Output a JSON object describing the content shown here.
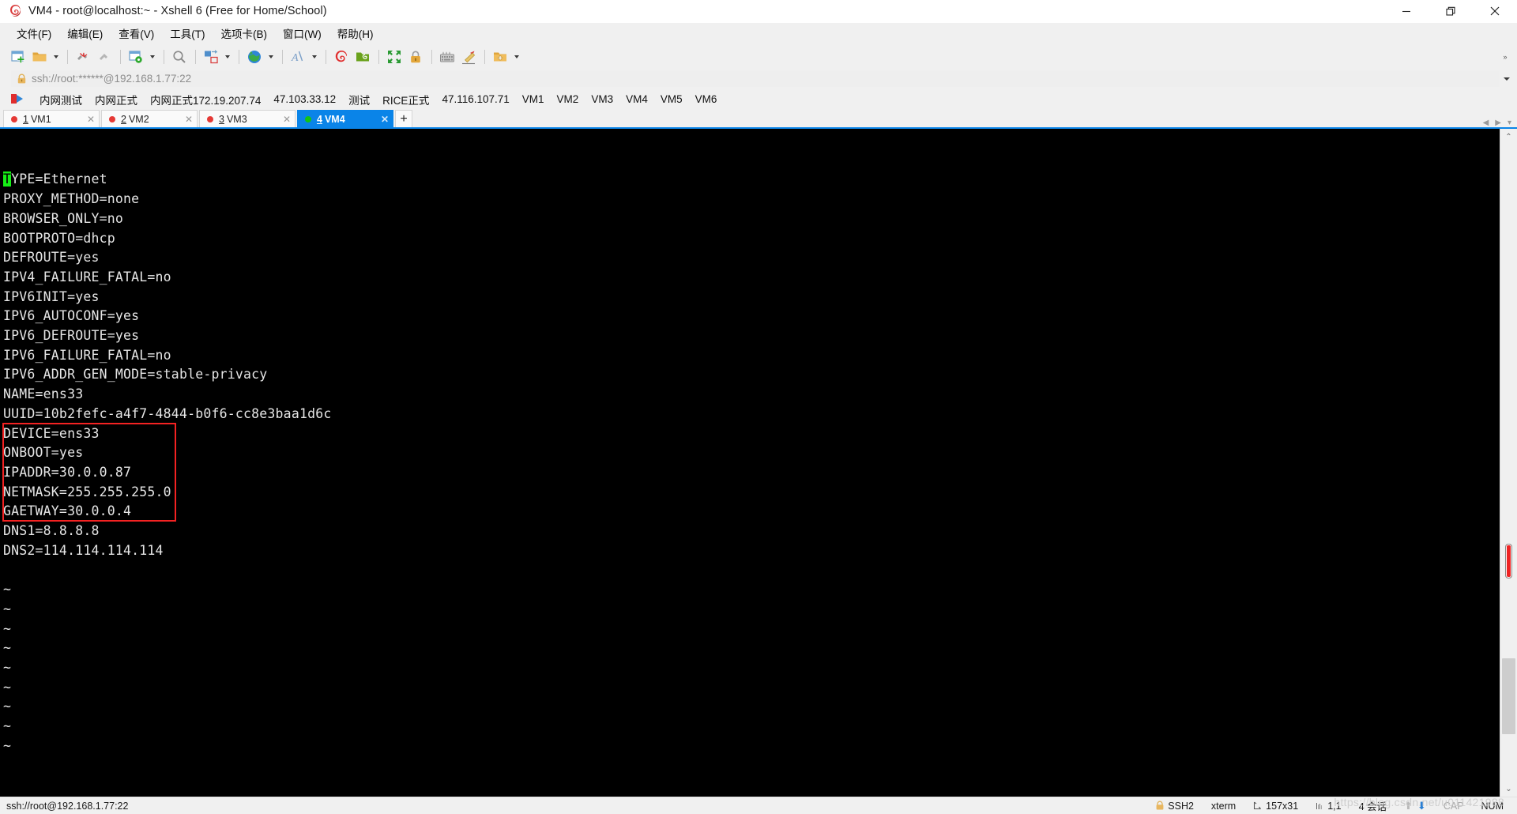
{
  "window": {
    "title": "VM4 - root@localhost:~ - Xshell 6 (Free for Home/School)",
    "app_icon": "xshell-spiral-icon",
    "minimize_label": "—",
    "maximize_label": "❐",
    "close_label": "✕"
  },
  "menu": {
    "items": [
      {
        "label": "文件(F)",
        "name": "menu-file"
      },
      {
        "label": "编辑(E)",
        "name": "menu-edit"
      },
      {
        "label": "查看(V)",
        "name": "menu-view"
      },
      {
        "label": "工具(T)",
        "name": "menu-tools"
      },
      {
        "label": "选项卡(B)",
        "name": "menu-tabs"
      },
      {
        "label": "窗口(W)",
        "name": "menu-window"
      },
      {
        "label": "帮助(H)",
        "name": "menu-help"
      }
    ]
  },
  "toolbar": {
    "collapse_label": "»",
    "buttons": [
      {
        "name": "new-session-icon",
        "title": "新建会话"
      },
      {
        "name": "open-folder-icon",
        "title": "打开"
      },
      {
        "name": "open-dropdown-arrow",
        "title": "打开下拉"
      },
      {
        "name": "disconnect-icon",
        "title": "断开"
      },
      {
        "name": "reconnect-icon",
        "title": "重新连接"
      },
      {
        "name": "session-properties-icon",
        "title": "属性"
      },
      {
        "name": "properties-dropdown-arrow",
        "title": "属性下拉"
      },
      {
        "name": "find-icon",
        "title": "查找"
      },
      {
        "name": "file-transfer-icon",
        "title": "文件传输"
      },
      {
        "name": "file-transfer-dropdown-arrow",
        "title": "文件传输下拉"
      },
      {
        "name": "globe-icon",
        "title": "编码"
      },
      {
        "name": "globe-dropdown-arrow",
        "title": "编码下拉"
      },
      {
        "name": "font-icon",
        "title": "字体"
      },
      {
        "name": "font-dropdown-arrow",
        "title": "字体下拉"
      },
      {
        "name": "xshell-icon",
        "title": "Xshell"
      },
      {
        "name": "xftp-icon",
        "title": "Xftp"
      },
      {
        "name": "fullscreen-icon",
        "title": "全屏"
      },
      {
        "name": "lock-icon",
        "title": "锁定"
      },
      {
        "name": "keyboard-icon",
        "title": "按键脚本"
      },
      {
        "name": "highlight-icon",
        "title": "高亮"
      },
      {
        "name": "add-folder-icon",
        "title": "新建文件夹"
      },
      {
        "name": "add-folder-dropdown-arrow",
        "title": "新建文件夹下拉"
      }
    ]
  },
  "address": {
    "value": "ssh://root:******@192.168.1.77:22",
    "placeholder": "ssh://",
    "lock_icon": "lock-icon",
    "dropdown_icon": "chevron-down-icon"
  },
  "bookmarks": {
    "flag_icon": "bookmark-flag-icon",
    "items": [
      "内网测试",
      "内网正式",
      "内网正式172.19.207.74",
      "47.103.33.12",
      "测试",
      "RICE正式",
      "47.116.107.71",
      "VM1",
      "VM2",
      "VM3",
      "VM4",
      "VM5",
      "VM6"
    ]
  },
  "tabs": {
    "items": [
      {
        "num": "1",
        "label": "VM1",
        "status": "disconnected",
        "active": false,
        "close": "✕"
      },
      {
        "num": "2",
        "label": "VM2",
        "status": "disconnected",
        "active": false,
        "close": "✕"
      },
      {
        "num": "3",
        "label": "VM3",
        "status": "disconnected",
        "active": false,
        "close": "✕"
      },
      {
        "num": "4",
        "label": "VM4",
        "status": "connected",
        "active": true,
        "close": "✕"
      }
    ],
    "new_tab_label": "+",
    "nav_prev": "◀",
    "nav_next": "▶",
    "nav_menu": "▾",
    "active_color": "#0a84e8",
    "connected_color": "#13c413",
    "disconnected_color": "#e53935"
  },
  "terminal": {
    "cursor_char": "T",
    "cursor_color": "#16f016",
    "background": "#000000",
    "foreground": "#e6e6e6",
    "lines": [
      "TYPE=Ethernet",
      "PROXY_METHOD=none",
      "BROWSER_ONLY=no",
      "BOOTPROTO=dhcp",
      "DEFROUTE=yes",
      "IPV4_FAILURE_FATAL=no",
      "IPV6INIT=yes",
      "IPV6_AUTOCONF=yes",
      "IPV6_DEFROUTE=yes",
      "IPV6_FAILURE_FATAL=no",
      "IPV6_ADDR_GEN_MODE=stable-privacy",
      "NAME=ens33",
      "UUID=10b2fefc-a4f7-4844-b0f6-cc8e3baa1d6c",
      "DEVICE=ens33",
      "ONBOOT=yes",
      "IPADDR=30.0.0.87",
      "NETMASK=255.255.255.0",
      "GAETWAY=30.0.0.4",
      "DNS1=8.8.8.8",
      "DNS2=114.114.114.114",
      "",
      "~",
      "~",
      "~",
      "~",
      "~",
      "~",
      "~",
      "~",
      "~"
    ],
    "highlight_box": {
      "color": "#f42222",
      "first_line": "IPADDR=30.0.0.87",
      "last_line": "DNS2=114.114.114.114"
    }
  },
  "scrollbar": {
    "up_arrow": "⌃",
    "down_arrow": "⌄",
    "marker_color": "#ee2222"
  },
  "statusbar": {
    "connection": "ssh://root@192.168.1.77:22",
    "protocol": "SSH2",
    "terminal_type": "xterm",
    "size_icon": "resize-icon",
    "size": "157x31",
    "cursor_icon": "cursor-pos-icon",
    "cursor_pos": "1,1",
    "sessions": "4 会话",
    "upload_arrow": "⬆",
    "download_arrow": "⬇",
    "cap": "CAP",
    "num": "NUM",
    "watermark": "https://blog.csdn.net/u011421988"
  }
}
